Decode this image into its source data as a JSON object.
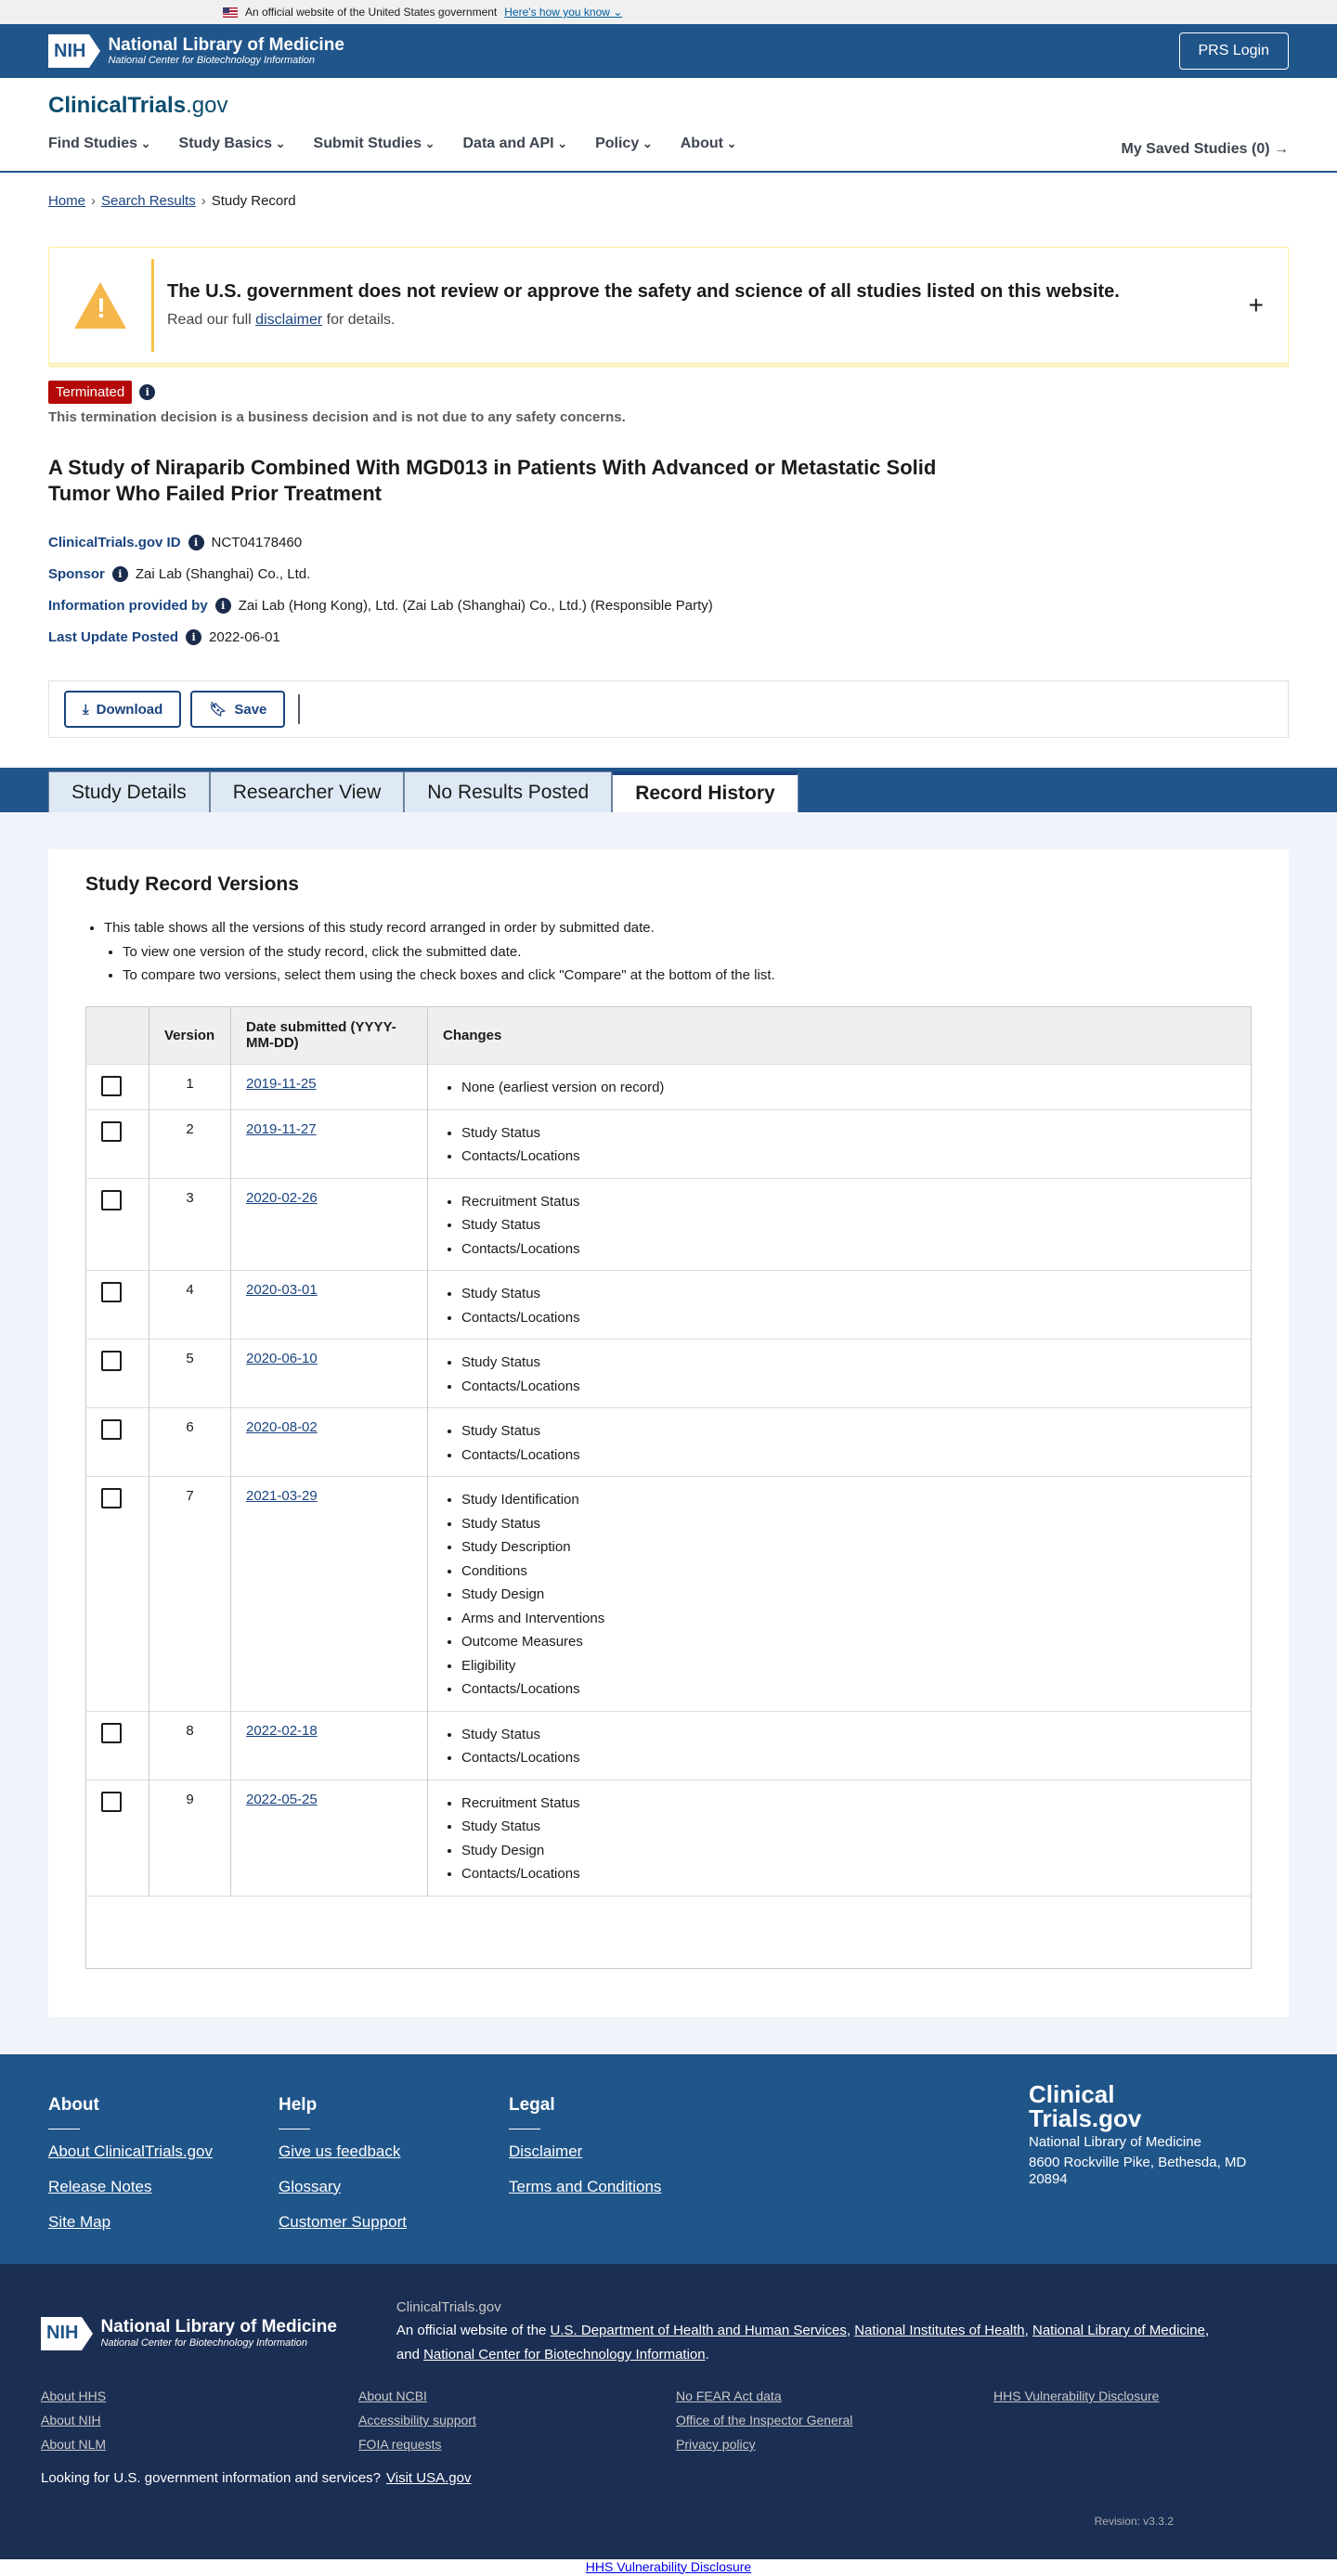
{
  "gov_banner": {
    "text": "An official website of the United States government",
    "link": "Here's how you know"
  },
  "nih_header": {
    "logo_abbr": "NIH",
    "logo_title": "National Library of Medicine",
    "logo_subtitle": "National Center for Biotechnology Information",
    "prs_login": "PRS Login"
  },
  "site": {
    "logo_main": "ClinicalTrials",
    "logo_suffix": ".gov"
  },
  "nav": [
    "Find Studies",
    "Study Basics",
    "Submit Studies",
    "Data and API",
    "Policy",
    "About"
  ],
  "saved_studies": "My Saved Studies (0) →",
  "breadcrumb": {
    "home": "Home",
    "search": "Search Results",
    "current": "Study Record",
    "sep": "›"
  },
  "disclaimer": {
    "title": "The U.S. government does not review or approve the safety and science of all studies listed on this website.",
    "pre": "Read our full",
    "link": "disclaimer",
    "post": "for details.",
    "expand": "+"
  },
  "status": {
    "badge": "Terminated",
    "note": "This termination decision is a business decision and is not due to any safety concerns."
  },
  "study": {
    "title": "A Study of Niraparib Combined With MGD013 in Patients With Advanced or Metastatic Solid Tumor Who Failed Prior Treatment",
    "id_label": "ClinicalTrials.gov ID",
    "id_value": "NCT04178460",
    "sponsor_label": "Sponsor",
    "sponsor_value": "Zai Lab (Shanghai) Co., Ltd.",
    "info_label": "Information provided by",
    "info_value": "Zai Lab (Hong Kong), Ltd. (Zai Lab (Shanghai) Co., Ltd.) (Responsible Party)",
    "update_label": "Last Update Posted",
    "update_value": "2022-06-01"
  },
  "actions": {
    "download": "Download",
    "save": "Save"
  },
  "tabs": [
    "Study Details",
    "Researcher View",
    "No Results Posted",
    "Record History"
  ],
  "versions": {
    "heading": "Study Record Versions",
    "notes": [
      "This table shows all the versions of this study record arranged in order by submitted date.",
      "To view one version of the study record, click the submitted date.",
      "To compare two versions, select them using the check boxes and click \"Compare\" at the bottom of the list."
    ],
    "columns": {
      "version": "Version",
      "date": "Date submitted (YYYY-MM-DD)",
      "changes": "Changes"
    },
    "rows": [
      {
        "version": "1",
        "date": "2019-11-25",
        "changes": [
          "None (earliest version on record)"
        ]
      },
      {
        "version": "2",
        "date": "2019-11-27",
        "changes": [
          "Study Status",
          "Contacts/Locations"
        ]
      },
      {
        "version": "3",
        "date": "2020-02-26",
        "changes": [
          "Recruitment Status",
          "Study Status",
          "Contacts/Locations"
        ]
      },
      {
        "version": "4",
        "date": "2020-03-01",
        "changes": [
          "Study Status",
          "Contacts/Locations"
        ]
      },
      {
        "version": "5",
        "date": "2020-06-10",
        "changes": [
          "Study Status",
          "Contacts/Locations"
        ]
      },
      {
        "version": "6",
        "date": "2020-08-02",
        "changes": [
          "Study Status",
          "Contacts/Locations"
        ]
      },
      {
        "version": "7",
        "date": "2021-03-29",
        "changes": [
          "Study Identification",
          "Study Status",
          "Study Description",
          "Conditions",
          "Study Design",
          "Arms and Interventions",
          "Outcome Measures",
          "Eligibility",
          "Contacts/Locations"
        ]
      },
      {
        "version": "8",
        "date": "2022-02-18",
        "changes": [
          "Study Status",
          "Contacts/Locations"
        ]
      },
      {
        "version": "9",
        "date": "2022-05-25",
        "changes": [
          "Recruitment Status",
          "Study Status",
          "Study Design",
          "Contacts/Locations"
        ]
      }
    ]
  },
  "footer": {
    "about": {
      "title": "About",
      "links": [
        "About ClinicalTrials.gov",
        "Release Notes",
        "Site Map"
      ]
    },
    "help": {
      "title": "Help",
      "links": [
        "Give us feedback",
        "Glossary",
        "Customer Support"
      ]
    },
    "legal": {
      "title": "Legal",
      "links": [
        "Disclaimer",
        "Terms and Conditions"
      ]
    },
    "brand": {
      "line1": "Clinical",
      "line2": "Trials.gov",
      "org": "National Library of Medicine",
      "address": "8600 Rockville Pike, Bethesda, MD 20894"
    }
  },
  "footer_bottom": {
    "site": "ClinicalTrials.gov",
    "official_pre": "An official website of the",
    "hhs": "U.S. Department of Health and Human Services",
    "nih": "National Institutes of Health",
    "nlm": "National Library of Medicine",
    "and": "and",
    "ncbi": "National Center for Biotechnology Information",
    "links": [
      "About HHS",
      "About NCBI",
      "No FEAR Act data",
      "HHS Vulnerability Disclosure",
      "About NIH",
      "Accessibility support",
      "Office of the Inspector General",
      "",
      "About NLM",
      "FOIA requests",
      "Privacy policy",
      ""
    ],
    "usa_text": "Looking for U.S. government information and services?",
    "usa_link": "Visit USA.gov",
    "revision": "Revision: v3.3.2"
  },
  "bottom_link": "HHS Vulnerability Disclosure"
}
